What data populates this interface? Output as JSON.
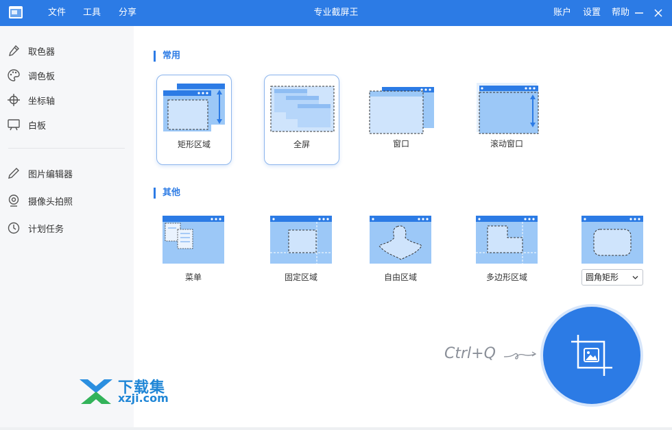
{
  "titlebar": {
    "menus": [
      "文件",
      "工具",
      "分享"
    ],
    "title": "专业截屏王",
    "right_menus": [
      "账户",
      "设置",
      "帮助"
    ]
  },
  "sidebar": {
    "group1": [
      {
        "label": "取色器",
        "icon": "eyedropper-icon"
      },
      {
        "label": "调色板",
        "icon": "palette-icon"
      },
      {
        "label": "坐标轴",
        "icon": "crosshair-icon"
      },
      {
        "label": "白板",
        "icon": "whiteboard-icon"
      }
    ],
    "group2": [
      {
        "label": "图片编辑器",
        "icon": "pencil-icon"
      },
      {
        "label": "摄像头拍照",
        "icon": "webcam-icon"
      },
      {
        "label": "计划任务",
        "icon": "clock-icon"
      }
    ]
  },
  "sections": {
    "common": {
      "title": "常用",
      "modes": [
        {
          "label": "矩形区域",
          "selected": true
        },
        {
          "label": "全屏",
          "selected": true
        },
        {
          "label": "窗口",
          "selected": false
        },
        {
          "label": "滚动窗口",
          "selected": false
        }
      ]
    },
    "other": {
      "title": "其他",
      "modes": [
        {
          "label": "菜单"
        },
        {
          "label": "固定区域"
        },
        {
          "label": "自由区域"
        },
        {
          "label": "多边形区域"
        }
      ],
      "shape_select": {
        "value": "圆角矩形"
      }
    }
  },
  "shortcut": "Ctrl+Q",
  "watermark": {
    "cn": "下载集",
    "en": "xzji.com"
  },
  "colors": {
    "accent": "#2c7be5",
    "light_fill": "#cfe4fc",
    "mid_fill": "#9cc8f7"
  }
}
